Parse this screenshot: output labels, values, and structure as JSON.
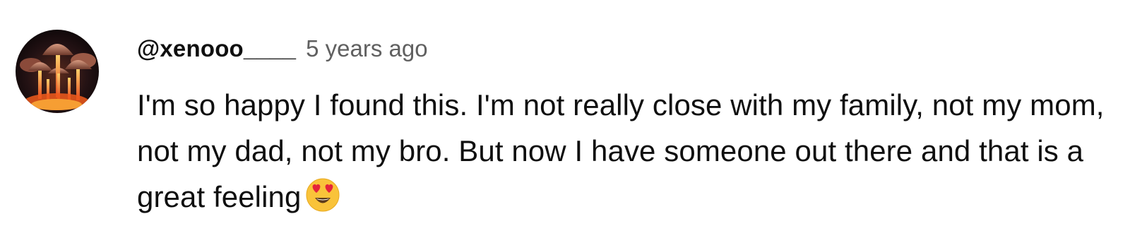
{
  "comment": {
    "author": "@xenooo____",
    "timestamp": "5 years ago",
    "text": "I'm so happy I found this. I'm not really close with my family, not my mom, not my dad, not my bro. But now I have someone out there and that is a great feeling",
    "emoji": "heart-eyes-emoji",
    "avatar_icon": "mushroom-avatar-image"
  },
  "colors": {
    "author": "#0f0f0f",
    "timestamp": "#606060",
    "text": "#0f0f0f",
    "background": "#ffffff",
    "emoji_face": "#f9c33a",
    "emoji_hearts": "#e5243b"
  }
}
